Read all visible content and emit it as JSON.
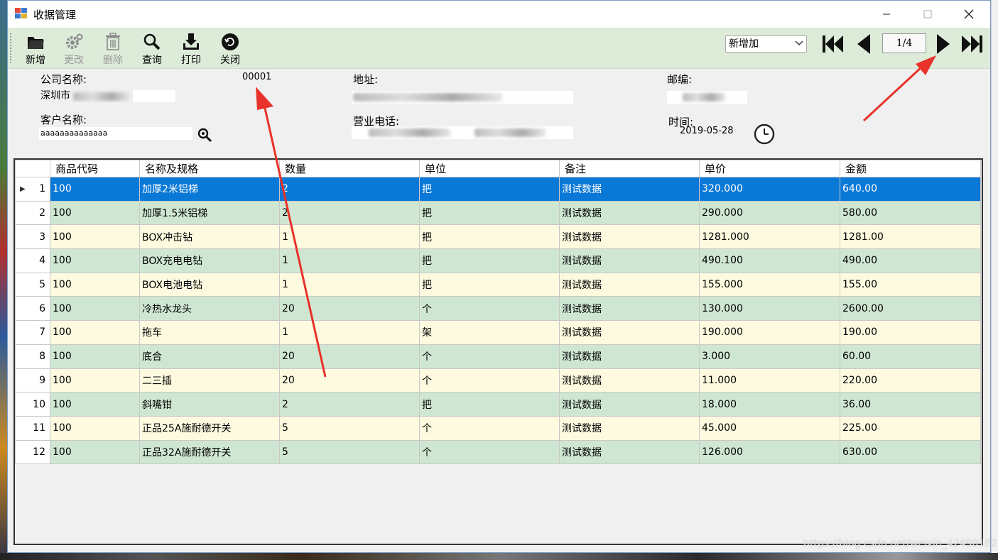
{
  "window": {
    "title": "收据管理"
  },
  "toolbar": {
    "buttons": [
      {
        "label": "新增",
        "enabled": true,
        "icon": "folder-open-icon"
      },
      {
        "label": "更改",
        "enabled": false,
        "icon": "gear-icon"
      },
      {
        "label": "删除",
        "enabled": false,
        "icon": "trash-icon"
      },
      {
        "label": "查询",
        "enabled": true,
        "icon": "magnifier-icon"
      },
      {
        "label": "打印",
        "enabled": true,
        "icon": "download-icon"
      },
      {
        "label": "关闭",
        "enabled": true,
        "icon": "close-circle-icon"
      }
    ],
    "mode": "新增加",
    "page": "1/4"
  },
  "form": {
    "company_label": "公司名称:",
    "company_code": "00001",
    "company_value": "深圳市",
    "address_label": "地址:",
    "postcode_label": "邮编:",
    "customer_label": "客户名称:",
    "customer_value": "aaaaaaaaaaaaaa",
    "phone_label": "营业电话:",
    "time_label": "时间:",
    "time_value": "2019-05-28"
  },
  "grid": {
    "columns": [
      "商品代码",
      "名称及规格",
      "数量",
      "单位",
      "备注",
      "单价",
      "金额"
    ],
    "rows": [
      [
        "1",
        "100",
        "加厚2米铝梯",
        "2",
        "把",
        "测试数据",
        "320.000",
        "640.00"
      ],
      [
        "2",
        "100",
        "加厚1.5米铝梯",
        "2",
        "把",
        "测试数据",
        "290.000",
        "580.00"
      ],
      [
        "3",
        "100",
        "BOX冲击钻",
        "1",
        "把",
        "测试数据",
        "1281.000",
        "1281.00"
      ],
      [
        "4",
        "100",
        "BOX充电电钻",
        "1",
        "把",
        "测试数据",
        "490.100",
        "490.00"
      ],
      [
        "5",
        "100",
        "BOX电池电钻",
        "1",
        "把",
        "测试数据",
        "155.000",
        "155.00"
      ],
      [
        "6",
        "100",
        "冷热水龙头",
        "20",
        "个",
        "测试数据",
        "130.000",
        "2600.00"
      ],
      [
        "7",
        "100",
        "拖车",
        "1",
        "架",
        "测试数据",
        "190.000",
        "190.00"
      ],
      [
        "8",
        "100",
        "底合",
        "20",
        "个",
        "测试数据",
        "3.000",
        "60.00"
      ],
      [
        "9",
        "100",
        "二三插",
        "20",
        "个",
        "测试数据",
        "11.000",
        "220.00"
      ],
      [
        "10",
        "100",
        "斜嘴钳",
        "2",
        "把",
        "测试数据",
        "18.000",
        "36.00"
      ],
      [
        "11",
        "100",
        "正品25A施耐德开关",
        "5",
        "个",
        "测试数据",
        "45.000",
        "225.00"
      ],
      [
        "12",
        "100",
        "正品32A施耐德开关",
        "5",
        "个",
        "测试数据",
        "126.000",
        "630.00"
      ]
    ]
  },
  "watermark": "https://blog.csdn.net/weixin_42490162",
  "colors": {
    "toolbar_bg": "#ddebd9",
    "row_odd": "#fdfadf",
    "row_even": "#cfe7d2",
    "row_selected": "#0a78d6",
    "annotation": "#e8322a"
  }
}
